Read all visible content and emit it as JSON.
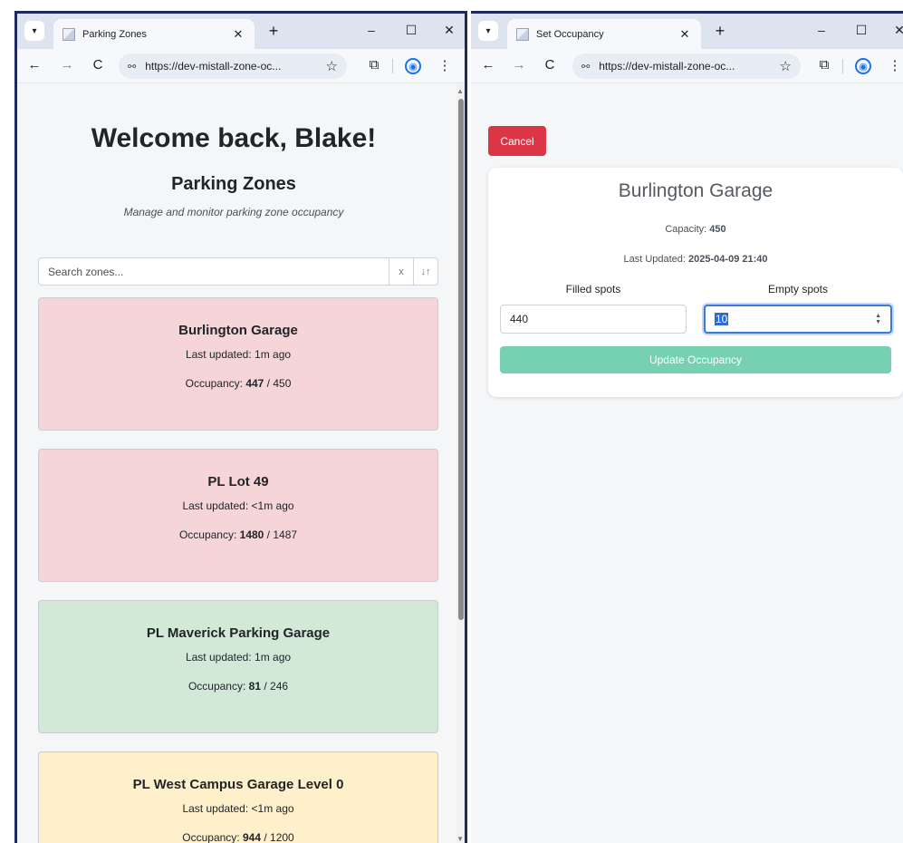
{
  "left_window": {
    "tab_title": "Parking Zones",
    "url": "https://dev-mistall-zone-oc...",
    "heading": "Welcome back, Blake!",
    "subheading": "Parking Zones",
    "subtitle": "Manage and monitor parking zone occupancy",
    "search": {
      "placeholder": "Search zones...",
      "clear_label": "x",
      "sort_label": "↓↑"
    },
    "zones": [
      {
        "name": "Burlington Garage",
        "last_updated": "Last updated: 1m ago",
        "occupancy_label": "Occupancy: ",
        "filled": "447",
        "capacity": " / 450",
        "status_color": "#f5d5d7"
      },
      {
        "name": "PL Lot 49",
        "last_updated": "Last updated: <1m ago",
        "occupancy_label": "Occupancy: ",
        "filled": "1480",
        "capacity": " / 1487",
        "status_color": "#f5d5d7"
      },
      {
        "name": "PL Maverick Parking Garage",
        "last_updated": "Last updated: 1m ago",
        "occupancy_label": "Occupancy: ",
        "filled": "81",
        "capacity": " / 246",
        "status_color": "#d2e9d8"
      },
      {
        "name": "PL West Campus Garage Level 0",
        "last_updated": "Last updated: <1m ago",
        "occupancy_label": "Occupancy: ",
        "filled": "944",
        "capacity": " / 1200",
        "status_color": "#fff0cc"
      }
    ]
  },
  "right_window": {
    "tab_title": "Set Occupancy",
    "url": "https://dev-mistall-zone-oc...",
    "cancel_label": "Cancel",
    "zone_name": "Burlington Garage",
    "capacity_label": "Capacity: ",
    "capacity_value": "450",
    "last_updated_label": "Last Updated: ",
    "last_updated_value": "2025-04-09 21:40",
    "filled_label": "Filled spots",
    "empty_label": "Empty spots",
    "filled_value": "440",
    "empty_value": "10",
    "update_label": "Update Occupancy"
  },
  "colors": {
    "cancel": "#dc3545",
    "update": "#75d1b1",
    "over_capacity": "#f5d5d7",
    "ok": "#d2e9d8",
    "warning": "#fff0cc"
  }
}
